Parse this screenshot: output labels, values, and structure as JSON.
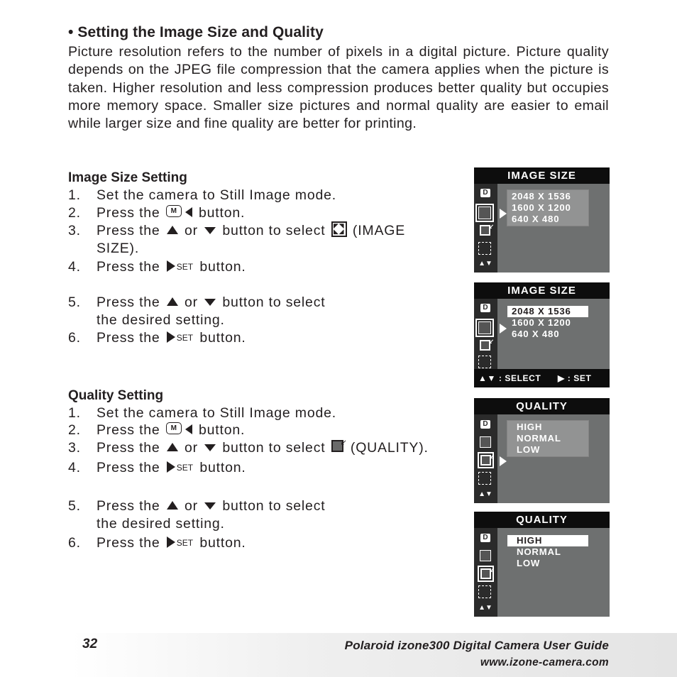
{
  "section": {
    "heading": "• Setting the Image Size and Quality",
    "intro": "Picture resolution refers to the number of pixels in a digital picture. Picture quality depends on the JPEG file compression that the camera applies when the picture is taken. Higher resolution and less compression produces better quality but occupies more memory space. Smaller size pictures and normal quality are easier to email while larger size and fine quality are better for printing."
  },
  "image_size_setting": {
    "title": "Image Size Setting",
    "steps": [
      {
        "num": "1.",
        "text": "Set the camera to Still Image mode."
      },
      {
        "num": "2.",
        "pre": "Press the",
        "icon": "menu-left-button",
        "post": "button."
      },
      {
        "num": "3.",
        "pre": "Press the",
        "mid1": "or",
        "mid2": "button to select",
        "icon": "image-size-icon",
        "post": "(IMAGE",
        "cont": "SIZE)."
      },
      {
        "num": "4.",
        "pre": "Press the",
        "set": "SET",
        "post": "button."
      },
      {
        "num": "5.",
        "pre": "Press the",
        "mid1": "or",
        "post": "button to select",
        "cont": "the desired setting."
      },
      {
        "num": "6.",
        "pre": "Press the",
        "set": "SET",
        "post": "button."
      }
    ]
  },
  "quality_setting": {
    "title": "Quality Setting",
    "steps": [
      {
        "num": "1.",
        "text": "Set the camera to Still Image mode."
      },
      {
        "num": "2.",
        "pre": "Press the",
        "icon": "menu-left-button",
        "post": "button."
      },
      {
        "num": "3.",
        "pre": "Press the",
        "mid1": "or",
        "mid2": "button to select",
        "icon": "quality-icon",
        "post": "(QUALITY)."
      },
      {
        "num": "4.",
        "pre": "Press the",
        "set": "SET",
        "post": "button."
      },
      {
        "num": "5.",
        "pre": "Press the",
        "mid1": "or",
        "post": "button to select",
        "cont": "the desired setting."
      },
      {
        "num": "6.",
        "pre": "Press the",
        "set": "SET",
        "post": "button."
      }
    ]
  },
  "menu_m_label": "M",
  "lcd_screens": [
    {
      "title": "IMAGE SIZE",
      "options": [
        "2048 X 1536",
        "1600 X 1200",
        "640 X 480"
      ],
      "selected": null,
      "active_icon": "image-size"
    },
    {
      "title": "IMAGE SIZE",
      "options": [
        "2048 X 1536",
        "1600 X 1200",
        "640 X 480"
      ],
      "selected": 0,
      "active_icon": "image-size",
      "footer": {
        "select": "▲▼ :  SELECT",
        "set": "▶ :  SET"
      }
    },
    {
      "title": "QUALITY",
      "options": [
        "HIGH",
        "NORMAL",
        "LOW"
      ],
      "selected": null,
      "active_icon": "quality"
    },
    {
      "title": "QUALITY",
      "options": [
        "HIGH",
        "NORMAL",
        "LOW"
      ],
      "selected": 0,
      "active_icon": "quality"
    }
  ],
  "lcd_side_icons": {
    "camera_mode": "D",
    "nav": "▲▼"
  },
  "footer": {
    "page_number": "32",
    "guide_title": "Polaroid izone300 Digital Camera User Guide",
    "url": "www.izone-camera.com"
  }
}
